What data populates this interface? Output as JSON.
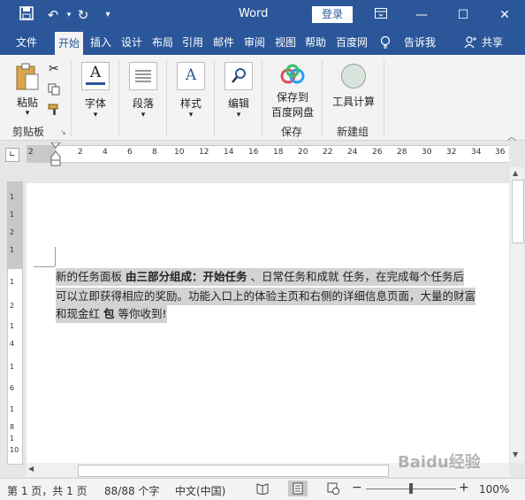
{
  "window": {
    "title": "Word",
    "login_label": "登录",
    "qa": {
      "save_icon": "save-icon",
      "undo_icon": "undo-icon",
      "redo_icon": "redo-icon",
      "customize_icon": "customize-icon"
    },
    "controls": {
      "ribbon_display": "ribbon-display-icon",
      "minimize": "minimize-icon",
      "maximize": "maximize-icon",
      "close": "close-icon"
    }
  },
  "tabs": [
    "文件",
    "开始",
    "插入",
    "设计",
    "布局",
    "引用",
    "邮件",
    "审阅",
    "视图",
    "帮助",
    "百度网"
  ],
  "tell_me": "告诉我",
  "share": "共享",
  "ribbon": {
    "clipboard": {
      "paste_label": "粘贴",
      "group_label": "剪贴板"
    },
    "font_label": "字体",
    "paragraph_label": "段落",
    "style_label": "样式",
    "edit_label": "编辑",
    "save_to_baidu_line1": "保存到",
    "save_to_baidu_line2": "百度网盘",
    "save_group_label": "保存",
    "tool_calc_label": "工具计算",
    "new_group_label": "新建组"
  },
  "ruler": {
    "ticks": [
      "2",
      "2",
      "4",
      "6",
      "8",
      "10",
      "12",
      "14",
      "16",
      "18",
      "20",
      "22",
      "24",
      "26",
      "28",
      "30",
      "32",
      "34",
      "36"
    ],
    "vticks": [
      "1",
      "1",
      "2",
      "1",
      "1",
      "2",
      "1",
      "4",
      "1",
      "6",
      "1",
      "8",
      "1",
      "10"
    ]
  },
  "document": {
    "line1_a": "新的任务面板 ",
    "line1_b": "由三部分组成：开始任务",
    "line1_c": " 、日常任务和成就  任务，在完成每个任务后",
    "line2": "可以立即获得相应的奖励。功能入口上的体验主页和右侧的详细信息页面，大量的财富",
    "line3_a": "和现金红 ",
    "line3_b": "包",
    "line3_c": "  等你收到!"
  },
  "status": {
    "page": "第 1 页，共 1 页",
    "words": "88/88 个字",
    "language": "中文(中国)",
    "zoom": "100%"
  },
  "watermark": "Baidu经验"
}
